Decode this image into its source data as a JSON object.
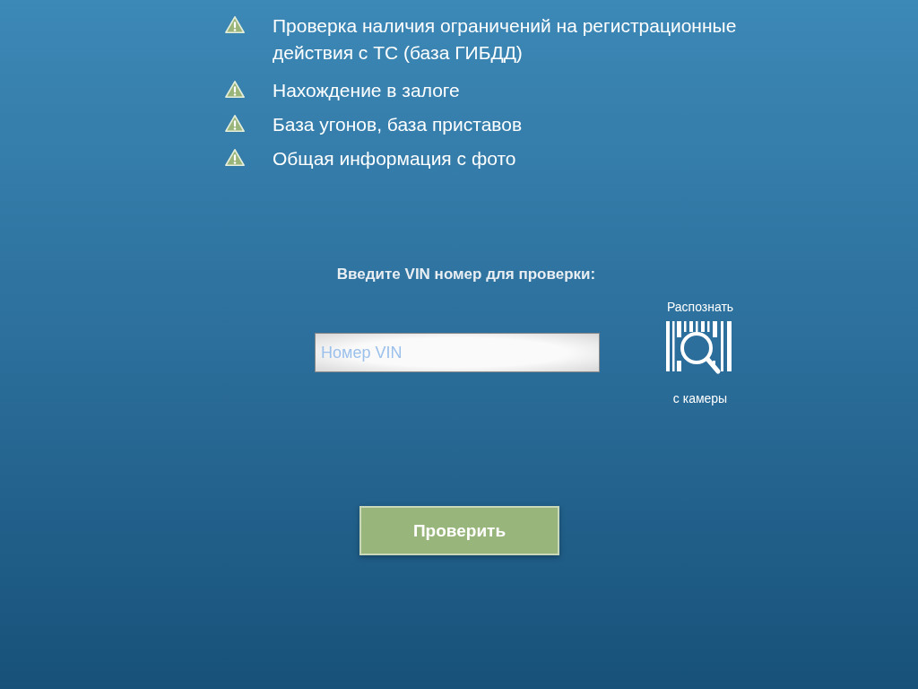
{
  "checks": [
    {
      "text": "Проверка наличия ограничений на регистрационные действия с ТС (база ГИБДД)"
    },
    {
      "text": "Нахождение в залоге"
    },
    {
      "text": "База угонов, база приставов"
    },
    {
      "text": "Общая информация с фото"
    }
  ],
  "prompt": "Введите VIN номер для проверки:",
  "vin_field": {
    "placeholder": "Номер VIN"
  },
  "scan": {
    "label_top": "Распознать",
    "label_bottom": "с камеры"
  },
  "submit_button": "Проверить"
}
